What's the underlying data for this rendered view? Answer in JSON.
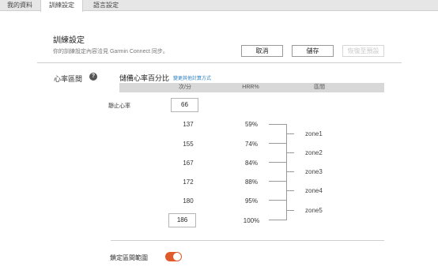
{
  "tabs": [
    {
      "label": "我的資料"
    },
    {
      "label": "訓練設定"
    },
    {
      "label": "語言設定"
    }
  ],
  "active_tab": 1,
  "header": {
    "title": "訓練設定",
    "description": "你的訓練設定內容洽見 Garmin Connect 同步。",
    "cancel_label": "取消",
    "save_label": "儲存",
    "defaults_label": "恢復至預設"
  },
  "hr_zones": {
    "label": "心率區間",
    "help_glyph": "?",
    "method": "儲備心率百分比",
    "change_link": "變更其他計算方式",
    "columns": {
      "bpm": "次/分",
      "hrr": "HRR%",
      "zone": "區間"
    },
    "resting_label": "靜止心率",
    "resting_value": "66",
    "boundaries": [
      {
        "bpm": "137",
        "hrr": "59%"
      },
      {
        "bpm": "155",
        "hrr": "74%"
      },
      {
        "bpm": "167",
        "hrr": "84%"
      },
      {
        "bpm": "172",
        "hrr": "88%"
      },
      {
        "bpm": "180",
        "hrr": "95%"
      }
    ],
    "max_value": "186",
    "max_hrr": "100%",
    "zones": [
      "zone1",
      "zone2",
      "zone3",
      "zone4",
      "zone5"
    ],
    "lock_label": "鎖定區間範圍",
    "lock_enabled": true
  },
  "colors": {
    "toggle_on": "#e05a2a",
    "link": "#2a7fc0"
  }
}
